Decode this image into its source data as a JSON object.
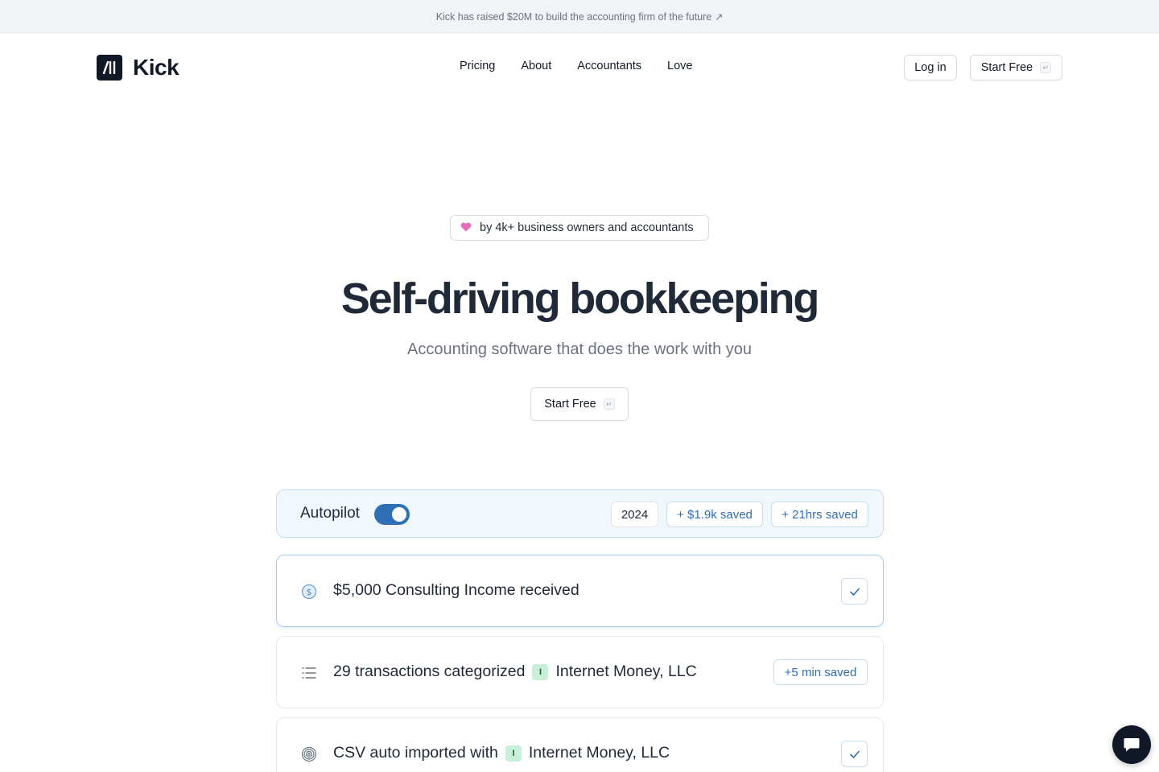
{
  "announcement": {
    "text": "Kick has raised $20M to build the accounting firm of the future",
    "arrow": "↗"
  },
  "nav": {
    "brand": "Kick",
    "links": [
      "Pricing",
      "About",
      "Accountants",
      "Love"
    ],
    "login_label": "Log in",
    "start_label": "Start Free",
    "enter_glyph": "↵"
  },
  "hero": {
    "badge_text": "by 4k+ business owners and accountants",
    "title": "Self-driving bookkeeping",
    "subtitle": "Accounting software that does the work with you",
    "cta_label": "Start Free"
  },
  "autopilot": {
    "label": "Autopilot",
    "toggle_on": true,
    "year": "2024",
    "saved_money": "+ $1.9k saved",
    "saved_time": "+ 21hrs saved"
  },
  "feed": [
    {
      "icon": "dollar-circle-icon",
      "text": "$5,000 Consulting Income received",
      "status": "check"
    },
    {
      "icon": "list-icon",
      "text": "29 transactions categorized",
      "tag": "I",
      "company": "Internet Money, LLC",
      "pill": "+5 min saved"
    },
    {
      "icon": "fingerprint-icon",
      "text": "CSV auto imported with",
      "tag": "I",
      "company": "Internet Money, LLC",
      "status": "check"
    }
  ],
  "colors": {
    "accent": "#2f6fb5",
    "dark": "#111827",
    "tag_bg": "#c8efd7",
    "heart": "#e46db8"
  }
}
